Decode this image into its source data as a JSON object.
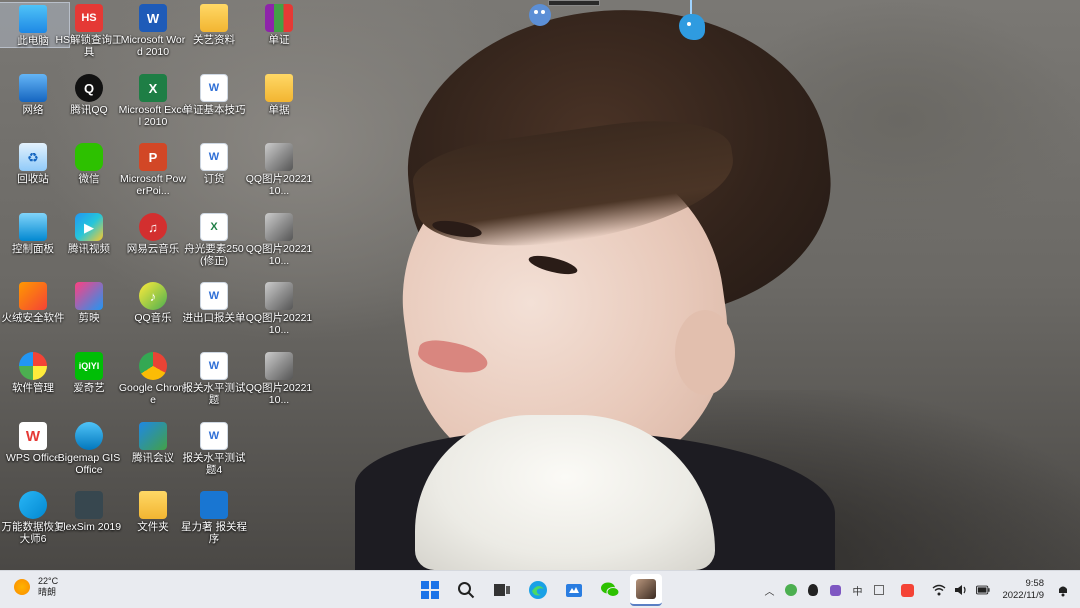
{
  "desktop": {
    "icons": [
      {
        "label": "此电脑",
        "icon": "computer-icon",
        "glyph": "",
        "cls": "g-pc"
      },
      {
        "label": "HS解锁查询工具",
        "icon": "hs-app-icon",
        "glyph": "HS",
        "cls": "g-hs"
      },
      {
        "label": "Microsoft Word 2010",
        "icon": "word-icon",
        "glyph": "W",
        "cls": "g-word"
      },
      {
        "label": "关艺资料",
        "icon": "folder-icon",
        "glyph": "",
        "cls": "g-folder"
      },
      {
        "label": "单证",
        "icon": "winrar-icon",
        "glyph": "",
        "cls": "g-rar"
      },
      {
        "label": "网络",
        "icon": "network-icon",
        "glyph": "",
        "cls": "g-net"
      },
      {
        "label": "腾讯QQ",
        "icon": "qq-icon",
        "glyph": "Q",
        "cls": "g-qq"
      },
      {
        "label": "Microsoft Excel 2010",
        "icon": "excel-icon",
        "glyph": "X",
        "cls": "g-excel"
      },
      {
        "label": "单证基本技巧",
        "icon": "word-doc-icon",
        "glyph": "W",
        "cls": "g-doc"
      },
      {
        "label": "单据",
        "icon": "folder-icon",
        "glyph": "",
        "cls": "g-folder"
      },
      {
        "label": "回收站",
        "icon": "recycle-bin-icon",
        "glyph": "♻",
        "cls": "g-bin"
      },
      {
        "label": "微信",
        "icon": "wechat-icon",
        "glyph": "",
        "cls": "g-wechat"
      },
      {
        "label": "Microsoft PowerPoi...",
        "icon": "powerpoint-icon",
        "glyph": "P",
        "cls": "g-ppt"
      },
      {
        "label": "订货",
        "icon": "word-doc-icon",
        "glyph": "W",
        "cls": "g-doc"
      },
      {
        "label": "QQ图片2022110...",
        "icon": "image-file-icon",
        "glyph": "",
        "cls": "g-img"
      },
      {
        "label": "控制面板",
        "icon": "control-panel-icon",
        "glyph": "",
        "cls": "g-ctrl"
      },
      {
        "label": "腾讯视频",
        "icon": "tencent-video-icon",
        "glyph": "▶",
        "cls": "g-video"
      },
      {
        "label": "网易云音乐",
        "icon": "netease-music-icon",
        "glyph": "♫",
        "cls": "g-music"
      },
      {
        "label": "舟光要素250 (修正)",
        "icon": "excel-doc-icon",
        "glyph": "X",
        "cls": "g-xls"
      },
      {
        "label": "QQ图片2022110...",
        "icon": "image-file-icon",
        "glyph": "",
        "cls": "g-img"
      },
      {
        "label": "火绒安全软件",
        "icon": "huorong-icon",
        "glyph": "",
        "cls": "g-fire"
      },
      {
        "label": "剪映",
        "icon": "app-icon",
        "glyph": "",
        "cls": "g-yq"
      },
      {
        "label": "QQ音乐",
        "icon": "qq-music-icon",
        "glyph": "♪",
        "cls": "g-qqm"
      },
      {
        "label": "进出口报关单",
        "icon": "word-doc-icon",
        "glyph": "W",
        "cls": "g-doc"
      },
      {
        "label": "QQ图片2022110...",
        "icon": "image-file-icon",
        "glyph": "",
        "cls": "g-img"
      },
      {
        "label": "软件管理",
        "icon": "software-manager-icon",
        "glyph": "",
        "cls": "g-soft"
      },
      {
        "label": "爱奇艺",
        "icon": "iqiyi-icon",
        "glyph": "iQIYI",
        "cls": "g-iqiyi"
      },
      {
        "label": "Google Chrome",
        "icon": "chrome-icon",
        "glyph": "",
        "cls": "g-chrome"
      },
      {
        "label": "报关水平测试题",
        "icon": "word-doc-icon",
        "glyph": "W",
        "cls": "g-doc"
      },
      {
        "label": "QQ图片2022110...",
        "icon": "image-file-icon",
        "glyph": "",
        "cls": "g-img"
      },
      {
        "label": "WPS Office",
        "icon": "wps-icon",
        "glyph": "W",
        "cls": "g-wps"
      },
      {
        "label": "Bigemap GIS Office",
        "icon": "bigemap-icon",
        "glyph": "",
        "cls": "g-bigemap"
      },
      {
        "label": "腾讯会议",
        "icon": "tencent-meeting-icon",
        "glyph": "",
        "cls": "g-meeting"
      },
      {
        "label": "报关水平测试题4",
        "icon": "word-doc-icon",
        "glyph": "W",
        "cls": "g-doc"
      },
      {
        "label": "万能数据恢复大师6",
        "icon": "data-recovery-icon",
        "glyph": "",
        "cls": "g-repair"
      },
      {
        "label": "FlexSim 2019",
        "icon": "flexsim-icon",
        "glyph": "",
        "cls": "g-flexsim"
      },
      {
        "label": "文件夹",
        "icon": "folder-icon",
        "glyph": "",
        "cls": "g-folder"
      },
      {
        "label": "星力著 报关程序",
        "icon": "app-window-icon",
        "glyph": "",
        "cls": "g-study"
      }
    ]
  },
  "taskbar": {
    "weather": {
      "temp": "22°C",
      "condition": "晴朗"
    },
    "apps": [
      {
        "name": "start-icon"
      },
      {
        "name": "search-icon"
      },
      {
        "name": "file-explorer-icon"
      },
      {
        "name": "edge-icon"
      },
      {
        "name": "store-icon"
      },
      {
        "name": "wechat-taskbar-icon"
      },
      {
        "name": "photo-viewer-icon"
      }
    ],
    "tray": {
      "ime_label": "中",
      "time": "9:58",
      "date": "2022/11/9"
    }
  }
}
